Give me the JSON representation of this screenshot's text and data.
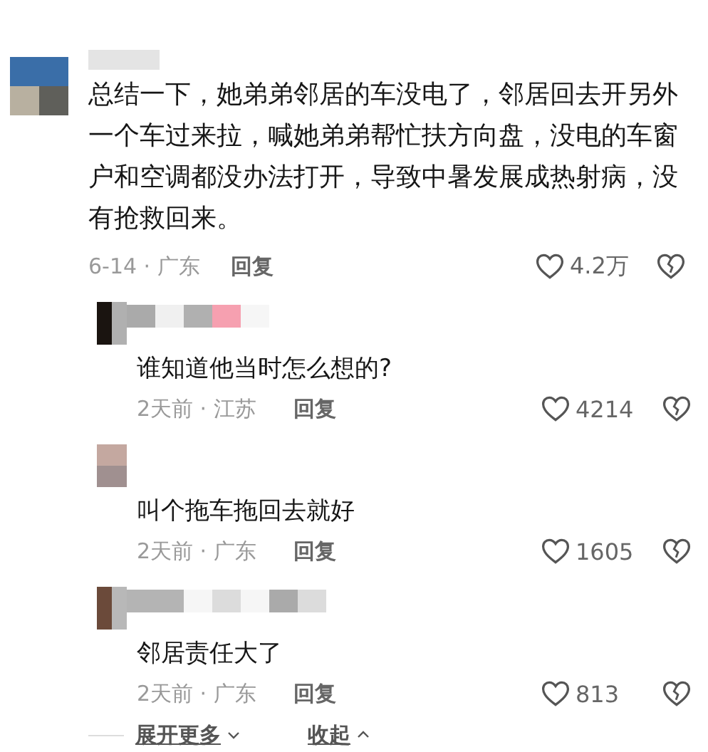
{
  "comment": {
    "text": "总结一下，她弟弟邻居的车没电了，邻居回去开另外一个车过来拉，喊她弟弟帮忙扶方向盘，没电的车窗户和空调都没办法打开，导致中暑发展成热射病，没有抢救回来。",
    "meta": "6-14 · 广东",
    "reply": "回复",
    "likes": "4.2万"
  },
  "replies": [
    {
      "text": "谁知道他当时怎么想的?",
      "meta": "2天前 · 江苏",
      "reply": "回复",
      "likes": "4214"
    },
    {
      "text": "叫个拖车拖回去就好",
      "meta": "2天前 · 广东",
      "reply": "回复",
      "likes": "1605"
    },
    {
      "text": "邻居责任大了",
      "meta": "2天前 · 广东",
      "reply": "回复",
      "likes": "813"
    }
  ],
  "footer": {
    "expand": "展开更多",
    "collapse": "收起"
  }
}
